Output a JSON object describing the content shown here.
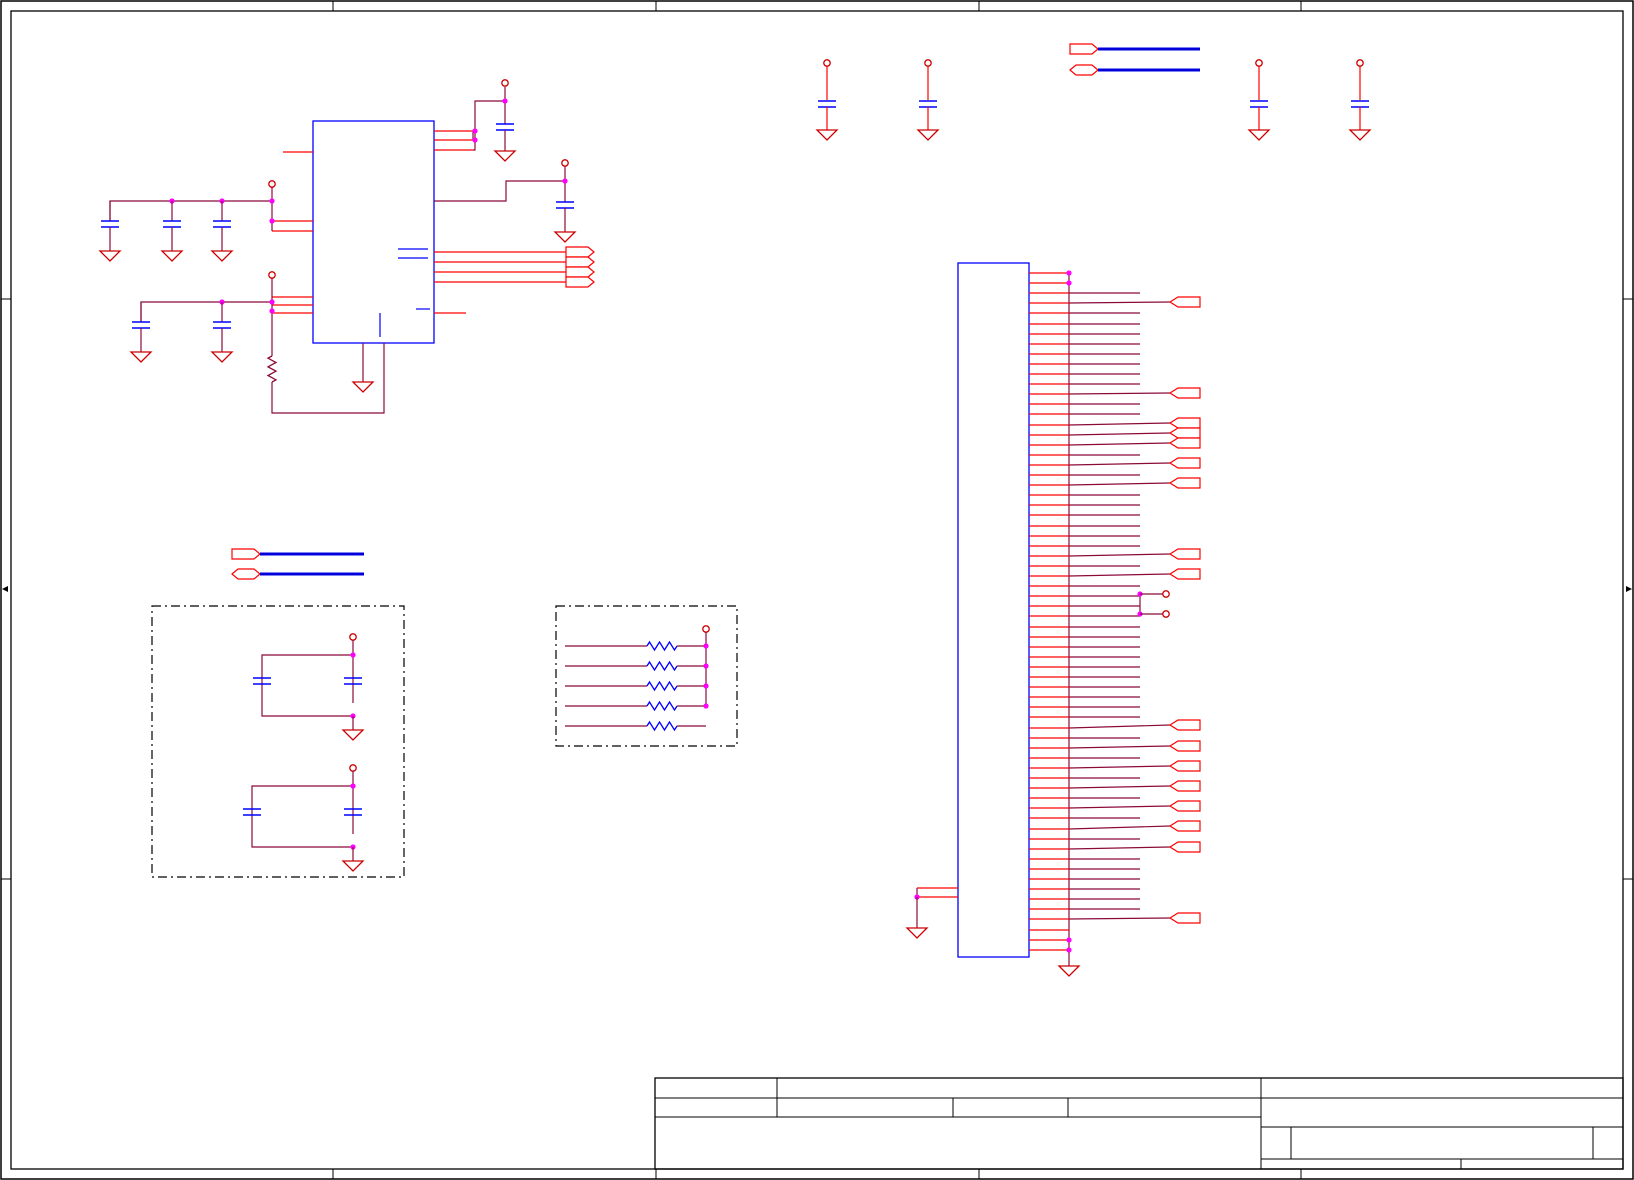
{
  "sheet": {
    "kind": "schematic",
    "text": []
  },
  "colors": {
    "frame": "#000000",
    "wire": "#ff0000",
    "net": "#8b0a3a",
    "component": "#0000ff",
    "bus": "#0000dd",
    "junction": "#ff00ff",
    "power_symbol": "#cc0000",
    "outline_dash": "#000000"
  },
  "components": {
    "regulator_ic": "ic-box",
    "connector_header": "connector-box",
    "decoupling_caps": "capacitor-symbols",
    "pullup_resistors": "resistor-symbols",
    "ground_symbols": "ground-icon",
    "power_pins": "power-pin-icon",
    "net_flags": "net-port-icon"
  },
  "title_block": {
    "fields": []
  }
}
